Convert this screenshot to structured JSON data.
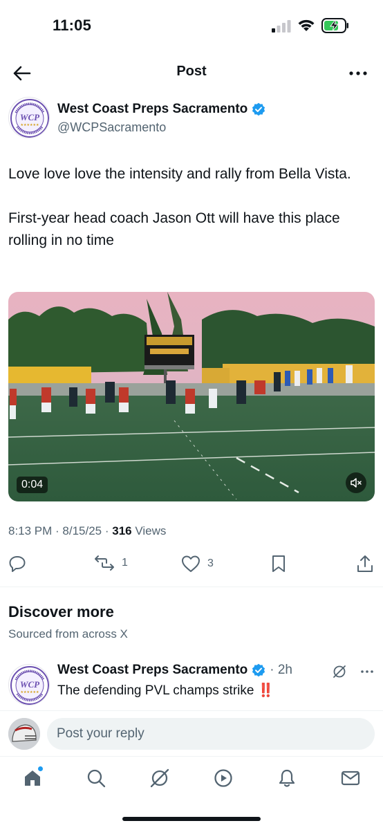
{
  "status_bar": {
    "time": "11:05"
  },
  "header": {
    "title": "Post"
  },
  "post": {
    "author_name": "West Coast Preps Sacramento",
    "author_handle": "@WCPSacramento",
    "text_paragraphs": [
      "Love love love the intensity and rally from Bella Vista.",
      "First-year head coach Jason Ott will have this place rolling in no time"
    ],
    "video_duration": "0:04",
    "timestamp": "8:13 PM · 8/15/25 · ",
    "views_count": "316",
    "views_label": " Views",
    "reposts": "1",
    "likes": "3"
  },
  "discover": {
    "title": "Discover more",
    "subtitle": "Sourced from across X"
  },
  "recommended_post": {
    "author_name": "West Coast Preps Sacramento",
    "time": "· 2h",
    "text": "The defending PVL champs strike ‼️"
  },
  "reply": {
    "placeholder": "Post your reply"
  },
  "avatar_text": {
    "logo": "WCP",
    "top": "WEST COAST PREPS",
    "bottom": "SACRAMENTO"
  },
  "colors": {
    "accent": "#1d9bf0",
    "text": "#0f1419",
    "secondary": "#536471",
    "logo_purple": "#6b4fb0"
  }
}
